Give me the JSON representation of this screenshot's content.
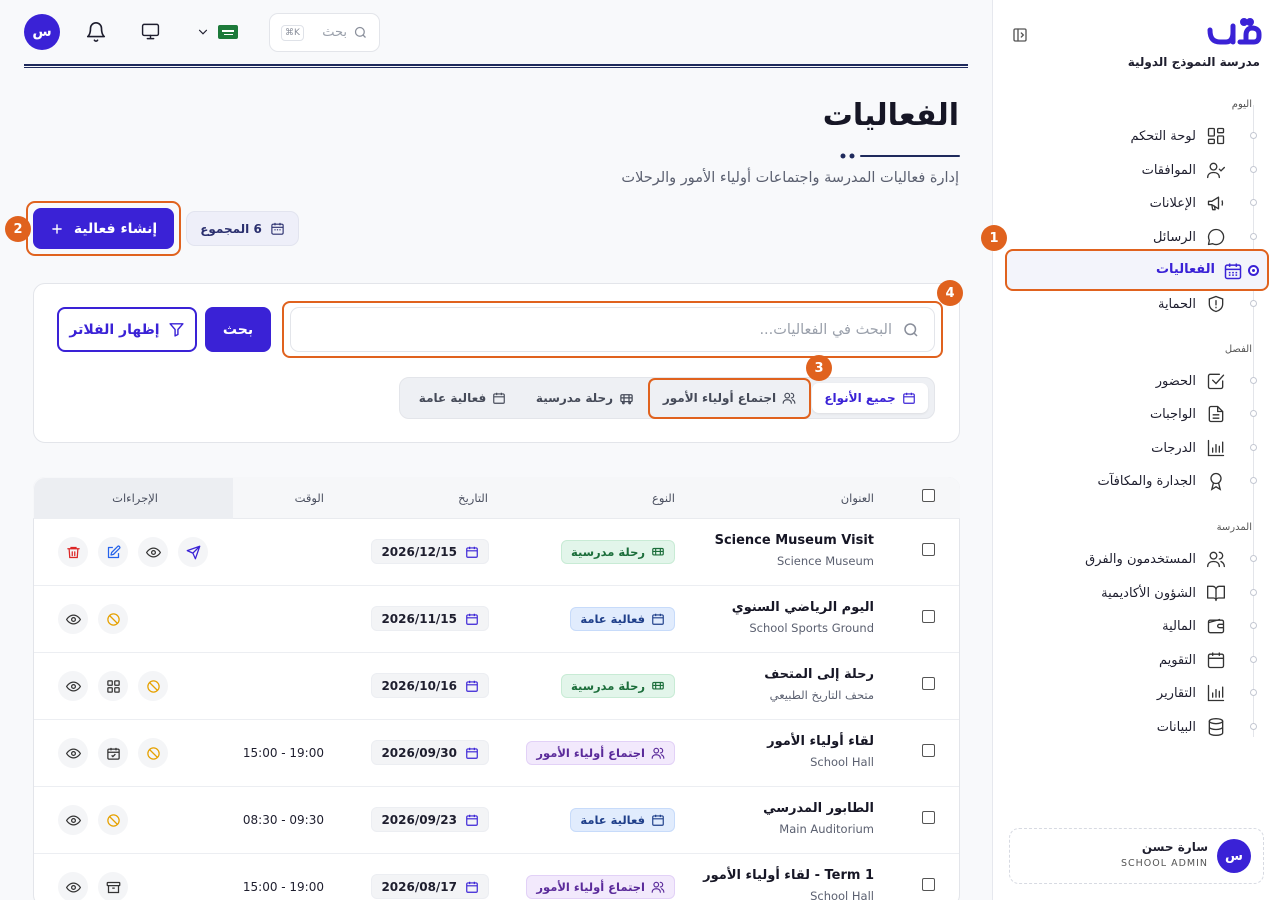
{
  "header": {
    "avatar_initial": "س",
    "search_placeholder": "بحث",
    "search_shortcut": "K⌘"
  },
  "sidebar": {
    "school_name": "مدرسة النموذج الدولية",
    "sections": [
      {
        "label": "اليوم"
      },
      {
        "label": "الفصل"
      },
      {
        "label": "المدرسة"
      }
    ],
    "items": [
      {
        "label": "لوحة التحكم",
        "icon": "dashboard-icon"
      },
      {
        "label": "الموافقات",
        "icon": "user-check-icon"
      },
      {
        "label": "الإعلانات",
        "icon": "megaphone-icon"
      },
      {
        "label": "الرسائل",
        "icon": "chat-icon"
      },
      {
        "label": "الفعاليات",
        "icon": "calendar-icon",
        "active": true
      },
      {
        "label": "الحماية",
        "icon": "shield-icon"
      },
      {
        "label": "الحضور",
        "icon": "check-square-icon"
      },
      {
        "label": "الواجبات",
        "icon": "file-icon"
      },
      {
        "label": "الدرجات",
        "icon": "bar-chart-icon"
      },
      {
        "label": "الجدارة والمكافآت",
        "icon": "award-icon"
      },
      {
        "label": "المستخدمون والفرق",
        "icon": "users-icon"
      },
      {
        "label": "الشؤون الأكاديمية",
        "icon": "book-icon"
      },
      {
        "label": "المالية",
        "icon": "wallet-icon"
      },
      {
        "label": "التقويم",
        "icon": "calendar-icon"
      },
      {
        "label": "التقارير",
        "icon": "bar-chart-icon"
      },
      {
        "label": "البيانات",
        "icon": "database-icon"
      }
    ],
    "user": {
      "initial": "س",
      "name": "سارة حسن",
      "role": "SCHOOL ADMIN"
    }
  },
  "annotations": [
    "1",
    "2",
    "3",
    "4"
  ],
  "page": {
    "title": "الفعاليات",
    "subtitle": "إدارة فعاليات المدرسة واجتماعات أولياء الأمور والرحلات",
    "create_label": "إنشاء فعالية",
    "total_label": "6 المجموع"
  },
  "filters": {
    "search_placeholder": "البحث في الفعاليات...",
    "search_button": "بحث",
    "filters_button": "إظهار الفلاتر",
    "tabs": [
      "جميع الأنواع",
      "اجتماع أولياء الأمور",
      "رحلة مدرسية",
      "فعالية عامة"
    ]
  },
  "table": {
    "headers": {
      "title": "العنوان",
      "type": "النوع",
      "date": "التاريخ",
      "time": "الوقت",
      "actions": "الإجراءات"
    },
    "rows": [
      {
        "title": "Science Museum Visit",
        "sub": "Science Museum",
        "type": "رحلة مدرسية",
        "kind": "trip",
        "date": "2026/12/15",
        "time": ""
      },
      {
        "title": "اليوم الرياضي السنوي",
        "sub": "School Sports Ground",
        "type": "فعالية عامة",
        "kind": "gen",
        "date": "2026/11/15",
        "time": ""
      },
      {
        "title": "رحلة إلى المتحف",
        "sub": "متحف التاريخ الطبيعي",
        "type": "رحلة مدرسية",
        "kind": "trip",
        "date": "2026/10/16",
        "time": ""
      },
      {
        "title": "لقاء أولياء الأمور",
        "sub": "School Hall",
        "type": "اجتماع أولياء الأمور",
        "kind": "par",
        "date": "2026/09/30",
        "time": "15:00 - 19:00"
      },
      {
        "title": "الطابور المدرسي",
        "sub": "Main Auditorium",
        "type": "فعالية عامة",
        "kind": "gen",
        "date": "2026/09/23",
        "time": "08:30 - 09:30"
      },
      {
        "title": "لقاء أولياء الأمور - Term 1",
        "sub": "School Hall",
        "type": "اجتماع أولياء الأمور",
        "kind": "par",
        "date": "2026/08/17",
        "time": "15:00 - 19:00"
      }
    ]
  },
  "colors": {
    "accent": "#3a22d6",
    "annotation": "#e0621e"
  }
}
